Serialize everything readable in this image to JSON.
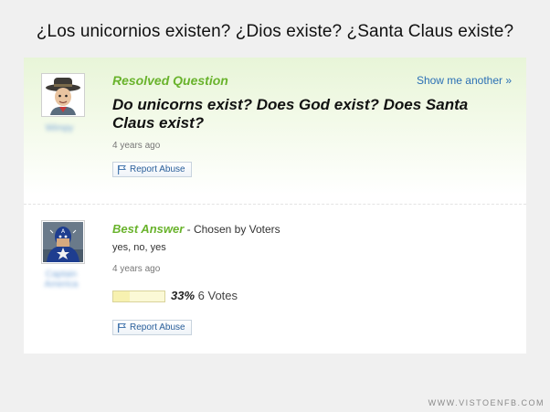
{
  "caption": "¿Los unicornios existen? ¿Dios existe? ¿Santa Claus existe?",
  "question": {
    "status_label": "Resolved Question",
    "show_another_label": "Show me another »",
    "title": "Do unicorns exist? Does God exist? Does Santa Claus exist?",
    "age": "4 years ago",
    "report_label": "Report Abuse",
    "asker_name": "Wimpy"
  },
  "answer": {
    "best_label": "Best Answer",
    "chosen_by": " - Chosen by Voters",
    "text": "yes, no, yes",
    "age": "4 years ago",
    "vote_percent_label": "33%",
    "vote_percent": 33,
    "votes_label": " 6 Votes",
    "report_label": "Report Abuse",
    "answerer_name": "Captain America"
  },
  "watermark": "WWW.VISTOENFB.COM",
  "colors": {
    "accent_green": "#69b32c",
    "link_blue": "#2a6fb5"
  }
}
